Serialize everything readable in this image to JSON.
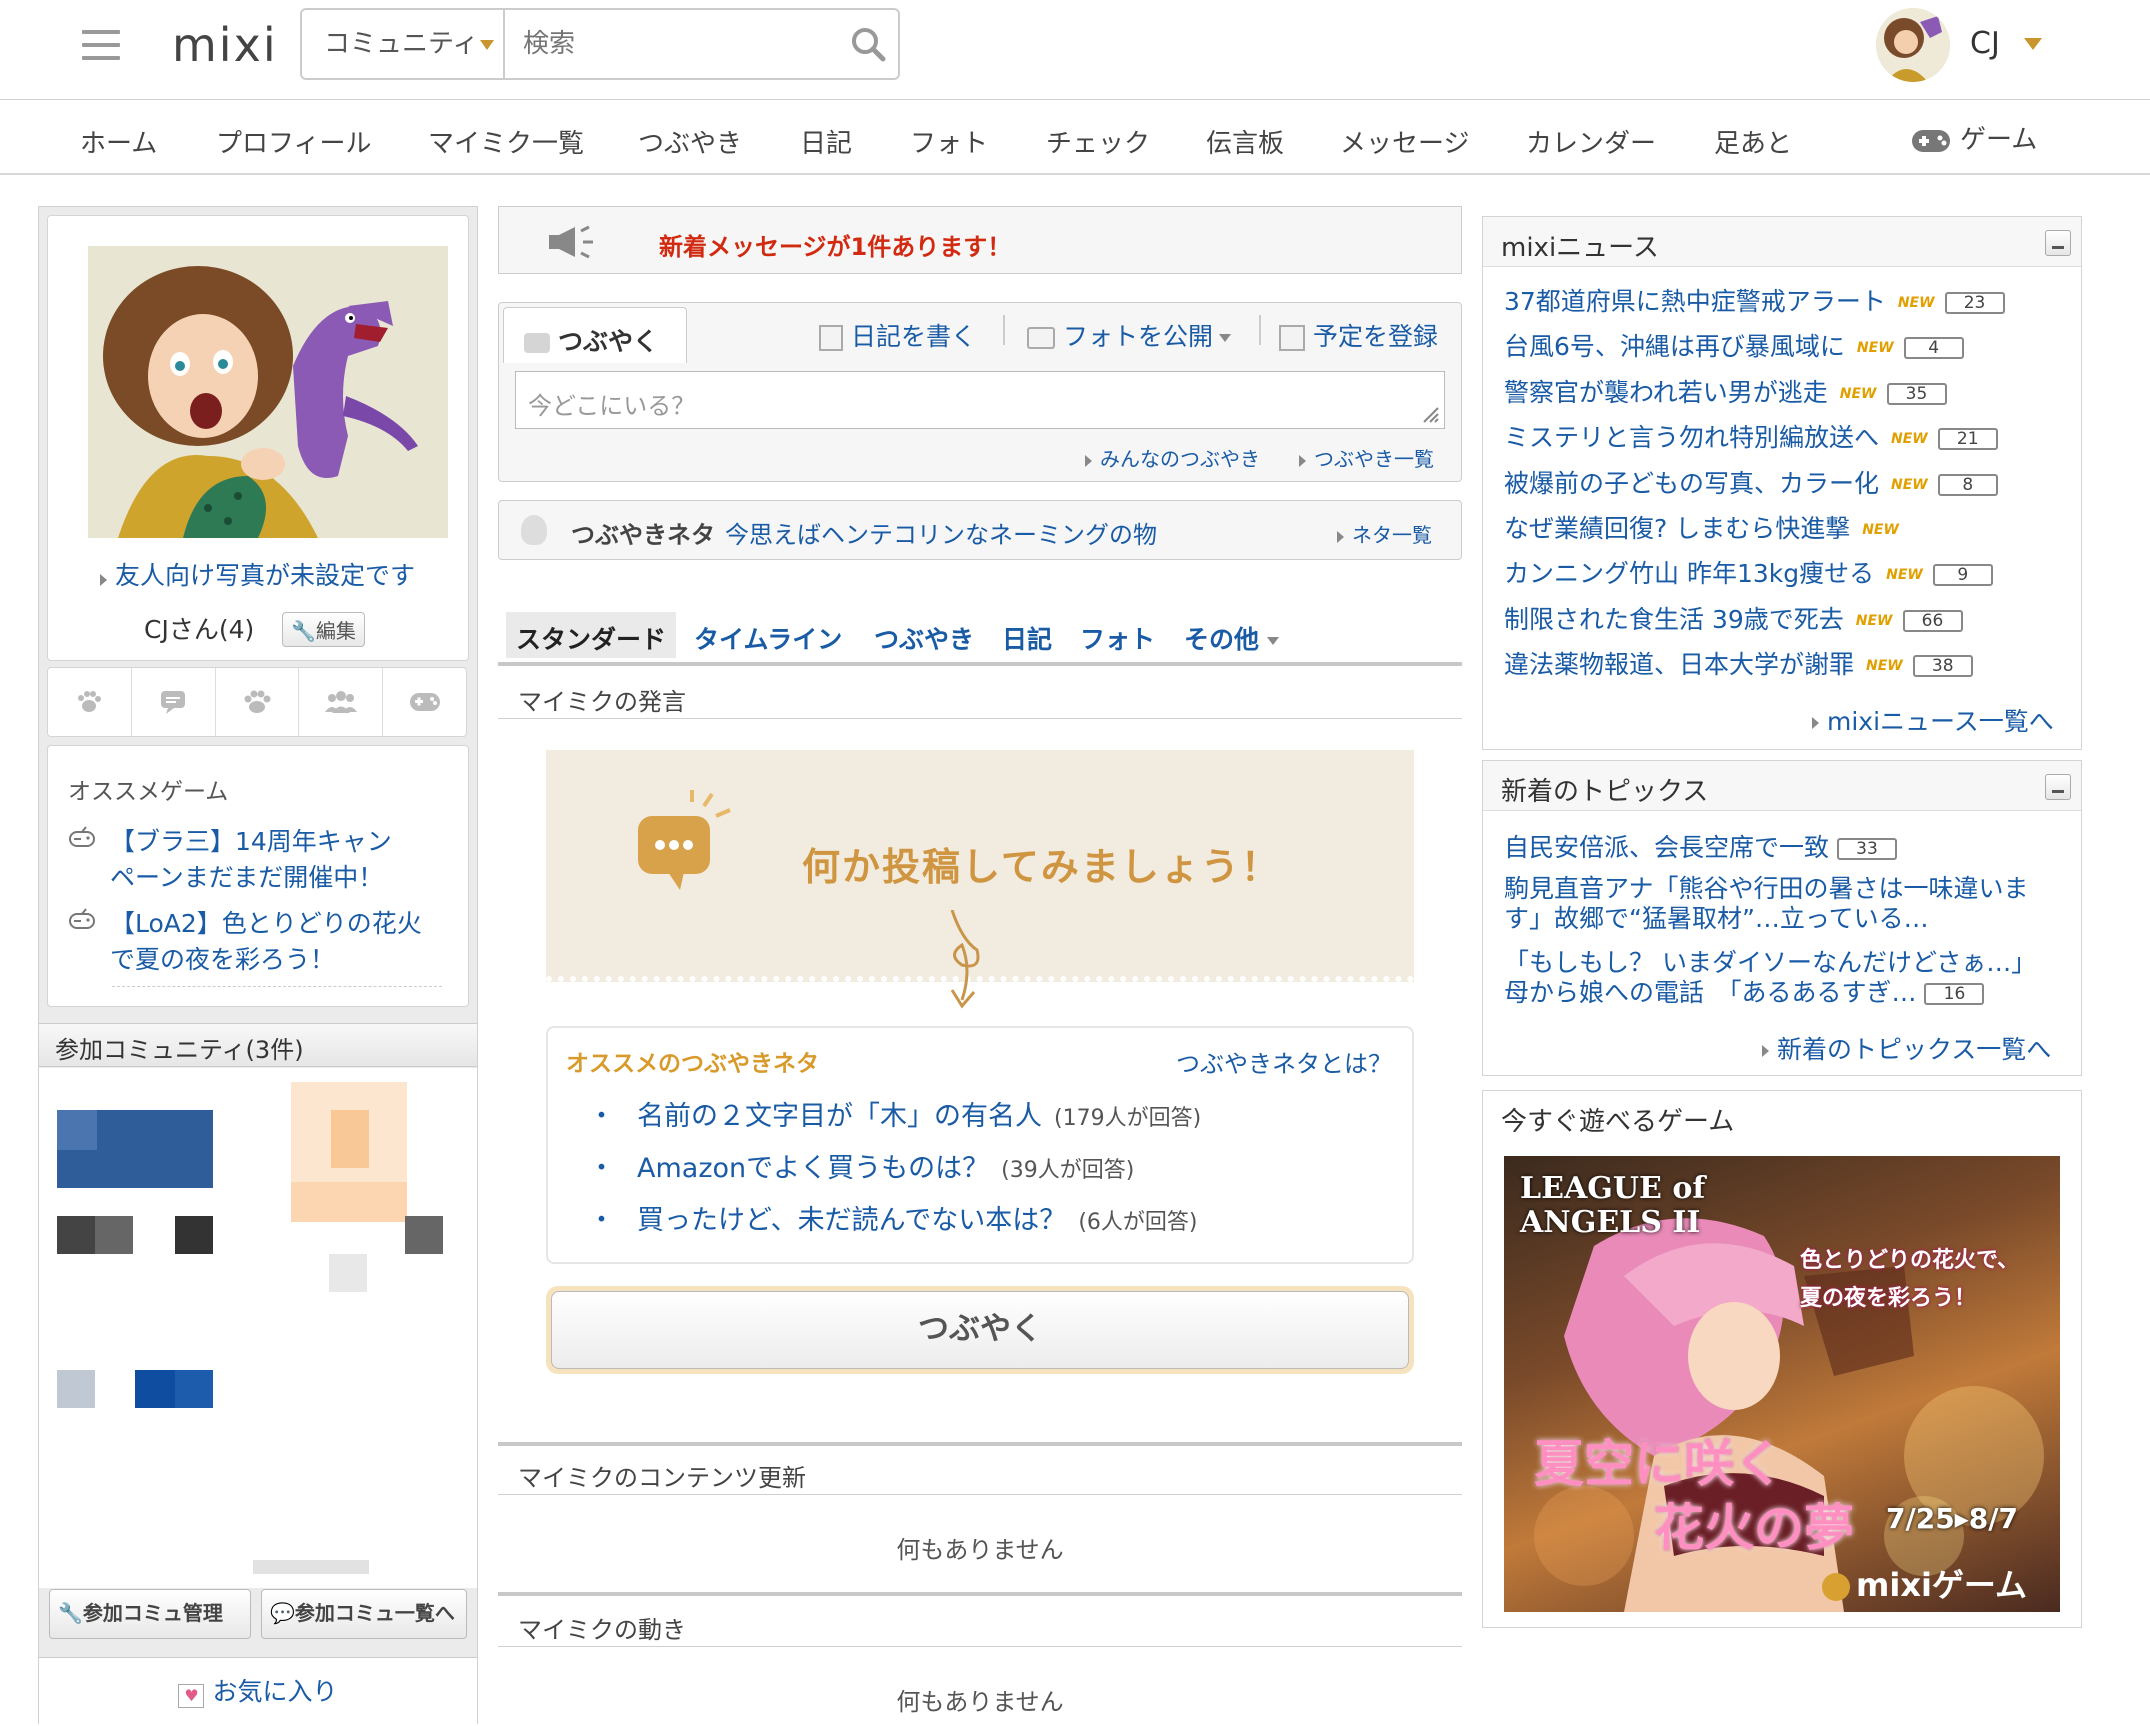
{
  "header": {
    "logo": "mixi",
    "search_category": "コミュニティ",
    "search_placeholder": "検索",
    "user_name": "CJ"
  },
  "nav": [
    "ホーム",
    "プロフィール",
    "マイミク一覧",
    "つぶやき",
    "日記",
    "フォト",
    "チェック",
    "伝言板",
    "メッセージ",
    "カレンダー",
    "足あと",
    "ゲーム"
  ],
  "profile": {
    "photo_notice": "友人向け写真が未設定です",
    "name": "CJさん(4)",
    "edit_label": "編集"
  },
  "games": {
    "title": "オススメゲーム",
    "items": [
      "【ブラ三】14周年キャン",
      "ペーンまだまだ開催中！",
      "【LoA2】色とりどりの花火",
      "で夏の夜を彩ろう！"
    ]
  },
  "communities": {
    "title": "参加コミュニティ(3件)",
    "manage_label": "参加コミュ管理",
    "list_label": "参加コミュ一覧へ",
    "favorites_label": "お気に入り"
  },
  "center": {
    "notice": "新着メッセージが1件あります！",
    "tweet_tab": "つぶやく",
    "diary_label": "日記を書く",
    "photo_label": "フォトを公開",
    "schedule_label": "予定を登録",
    "tweet_placeholder": "今どこにいる？",
    "everyone_tweets": "みんなのつぶやき",
    "tweets_list": "つぶやき一覧",
    "neta_label": "つぶやきネタ",
    "neta_text": "今思えばヘンテコリンなネーミングの物",
    "neta_list": "ネタ一覧",
    "tabs": [
      "スタンダード",
      "タイムライン",
      "つぶやき",
      "日記",
      "フォト",
      "その他"
    ],
    "friends_voice": "マイミクの発言",
    "post_prompt": "何か投稿してみましょう！",
    "rec_title": "オススメのつぶやきネタ",
    "rec_about": "つぶやきネタとは？",
    "rec_items": [
      {
        "text": "名前の２文字目が「木」の有名人",
        "count": "(179人が回答)"
      },
      {
        "text": "Amazonでよく買うものは？",
        "count": "(39人が回答)"
      },
      {
        "text": "買ったけど、未だ読んでない本は？",
        "count": "(6人が回答)"
      }
    ],
    "tweet_button": "つぶやく",
    "content_updates": "マイミクのコンテンツ更新",
    "nothing1": "何もありません",
    "friends_activity": "マイミクの動き",
    "nothing2": "何もありません"
  },
  "news": {
    "title": "mixiニュース",
    "new_tag": "NEW",
    "items": [
      {
        "title": "37都道府県に熱中症警戒アラート",
        "count": "23"
      },
      {
        "title": "台風6号、沖縄は再び暴風域に",
        "count": "4"
      },
      {
        "title": "警察官が襲われ若い男が逃走",
        "count": "35"
      },
      {
        "title": "ミステリと言う勿れ特別編放送へ",
        "count": "21"
      },
      {
        "title": "被爆前の子どもの写真、カラー化",
        "count": "8"
      },
      {
        "title": "なぜ業績回復? しまむら快進撃",
        "count": ""
      },
      {
        "title": "カンニング竹山 昨年13kg痩せる",
        "count": "9"
      },
      {
        "title": "制限された食生活 39歳で死去",
        "count": "66"
      },
      {
        "title": "違法薬物報道、日本大学が謝罪",
        "count": "38"
      }
    ],
    "more": "mixiニュース一覧へ"
  },
  "topics": {
    "title": "新着のトピックス",
    "t1": "自民安倍派、会長空席で一致",
    "c1": "33",
    "t2a": "駒見直音アナ「熊谷や行田の暑さは一味違いま",
    "t2b": "す」故郷で“猛暑取材”…立っている…",
    "t3a": "「もしもし？ いまダイソーなんだけどさぁ…」",
    "t3b": "母から娘への電話　「あるあるすぎ…",
    "c3": "16",
    "more": "新着のトピックス一覧へ"
  },
  "ad": {
    "title": "今すぐ遊べるゲーム",
    "logo1": "LEAGUE of",
    "logo2": "ANGELS II",
    "line1": "色とりどりの花火で、",
    "line2": "夏の夜を彩ろう！",
    "big1": "夏空に咲く",
    "big2": "花火の夢",
    "dates": "7/25▸8/7",
    "brand": "mixiゲーム"
  }
}
